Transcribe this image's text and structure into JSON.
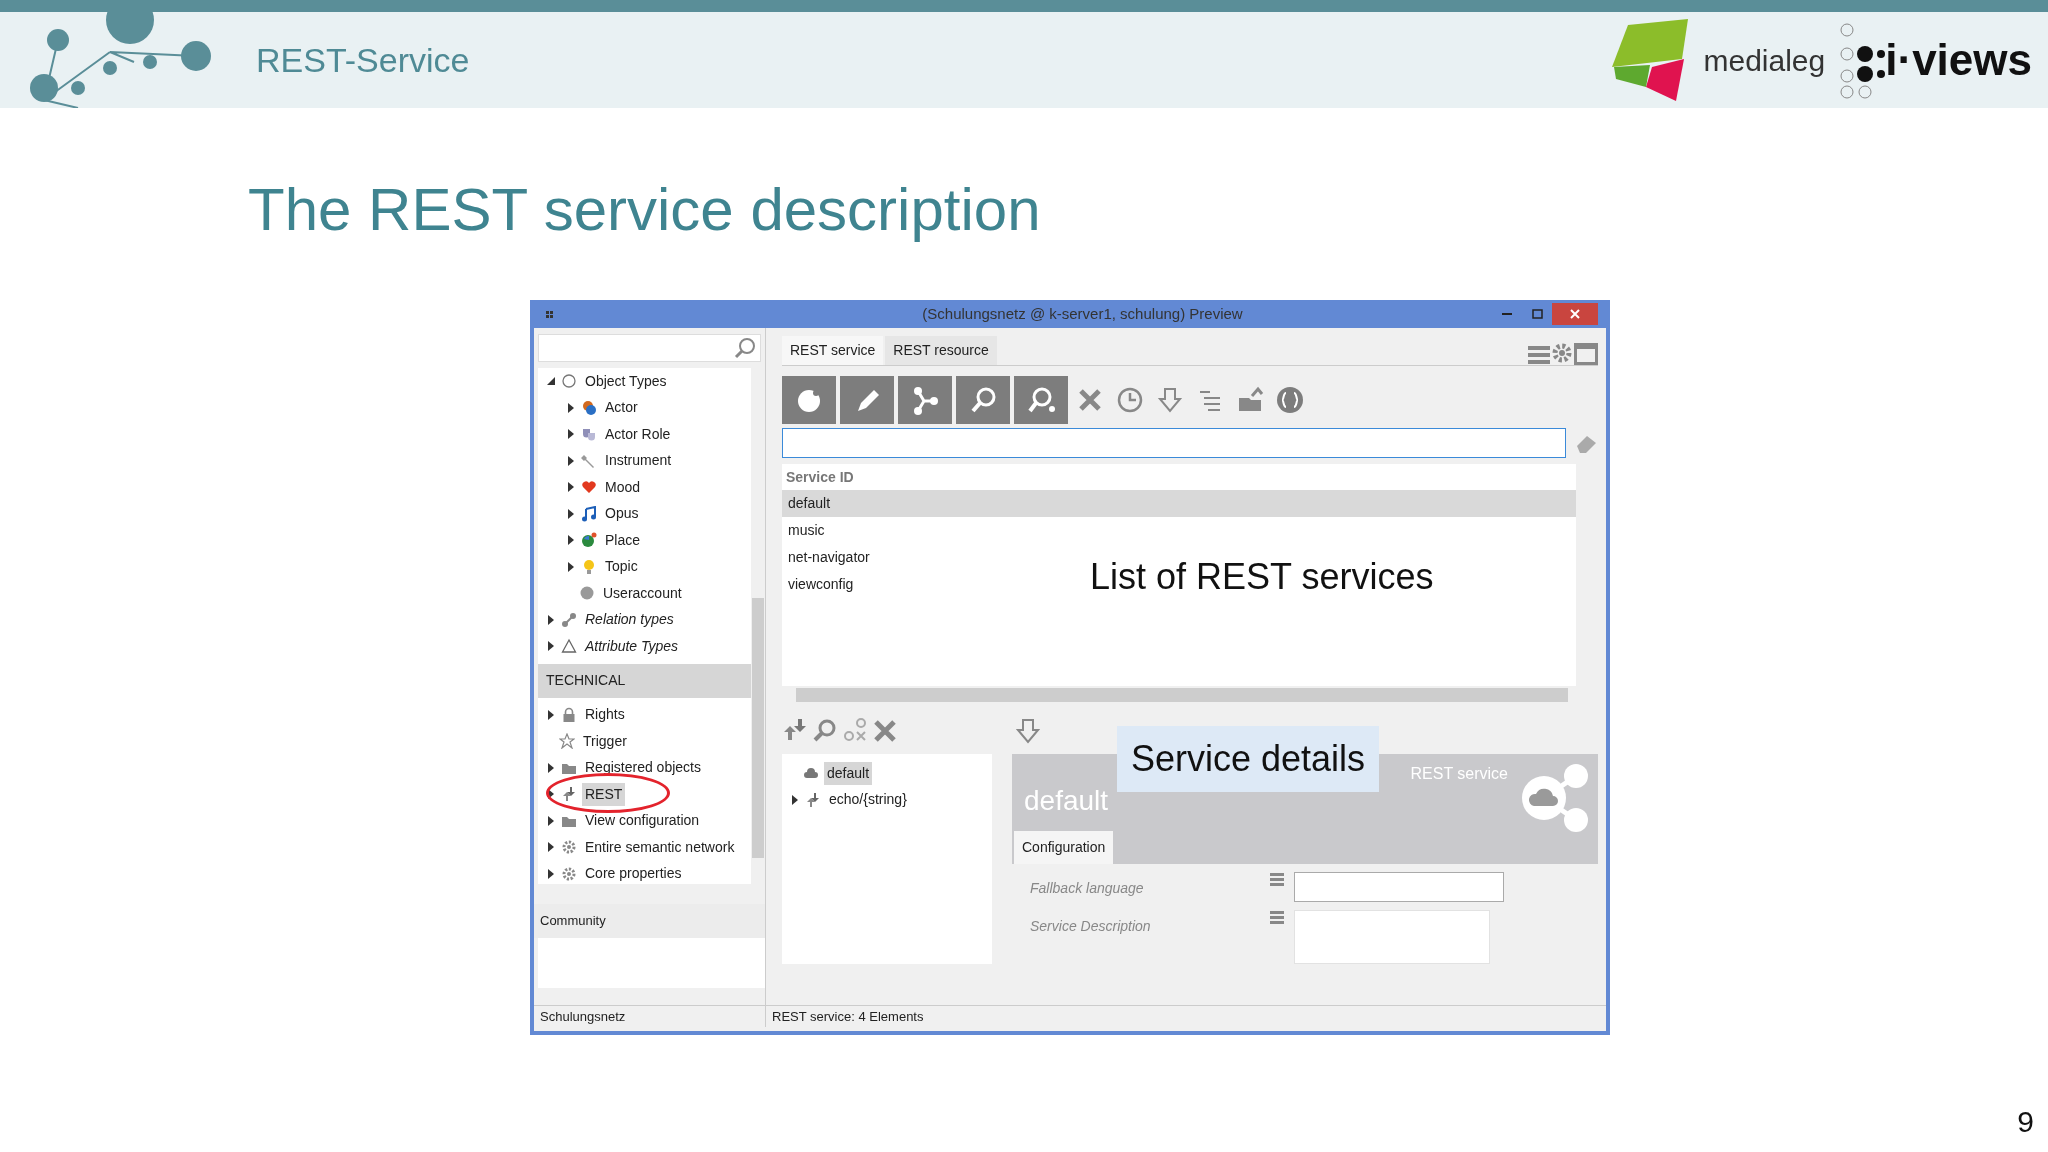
{
  "header": {
    "title": "REST-Service",
    "brand": "medialeg",
    "product": "i·views"
  },
  "slide_title": "The REST service description",
  "window": {
    "title": "(Schulungsnetz @ k-server1, schulung) Preview",
    "tree": [
      {
        "label": "Object Types",
        "kind": "ring",
        "italic": false,
        "expandable": true,
        "expanded": true,
        "selected": false,
        "children": [
          {
            "label": "Actor",
            "kind": "actor",
            "italic": false,
            "expandable": true,
            "selected": false
          },
          {
            "label": "Actor Role",
            "kind": "role",
            "italic": false,
            "expandable": true,
            "selected": false
          },
          {
            "label": "Instrument",
            "kind": "wrench",
            "italic": false,
            "expandable": true,
            "selected": false
          },
          {
            "label": "Mood",
            "kind": "heart",
            "italic": false,
            "expandable": true,
            "selected": false
          },
          {
            "label": "Opus",
            "kind": "note",
            "italic": false,
            "expandable": true,
            "selected": false
          },
          {
            "label": "Place",
            "kind": "globe",
            "italic": false,
            "expandable": true,
            "selected": false
          },
          {
            "label": "Topic",
            "kind": "bulb",
            "italic": false,
            "expandable": true,
            "selected": false
          },
          {
            "label": "Useraccount",
            "kind": "dot",
            "italic": false,
            "expandable": false,
            "selected": false
          }
        ]
      },
      {
        "label": "Relation types",
        "kind": "link",
        "italic": true,
        "expandable": true,
        "selected": false
      },
      {
        "label": "Attribute Types",
        "kind": "triangle",
        "italic": true,
        "expandable": true,
        "selected": false
      }
    ],
    "technical_heading": "TECHNICAL",
    "technical": [
      {
        "label": "Rights",
        "kind": "lock",
        "italic": false,
        "expandable": true,
        "selected": false
      },
      {
        "label": "Trigger",
        "kind": "star",
        "italic": false,
        "expandable": false,
        "selected": false
      },
      {
        "label": "Registered objects",
        "kind": "folder",
        "italic": false,
        "expandable": true,
        "selected": false
      },
      {
        "label": "REST",
        "kind": "rest",
        "italic": false,
        "expandable": true,
        "selected": true
      },
      {
        "label": "View configuration",
        "kind": "folder",
        "italic": false,
        "expandable": true,
        "selected": false
      },
      {
        "label": "Entire semantic network",
        "kind": "gear",
        "italic": false,
        "expandable": true,
        "selected": false
      },
      {
        "label": "Core properties",
        "kind": "gear",
        "italic": false,
        "expandable": true,
        "selected": false
      }
    ],
    "community_heading": "Community",
    "tabs": [
      {
        "label": "REST service",
        "selected": true
      },
      {
        "label": "REST resource",
        "selected": false
      }
    ],
    "columns": [
      "Service ID"
    ],
    "rows": [
      {
        "text": "default",
        "selected": true
      },
      {
        "text": "music",
        "selected": false
      },
      {
        "text": "net-navigator",
        "selected": false
      },
      {
        "text": "viewconfig",
        "selected": false
      }
    ],
    "resources": [
      {
        "label": "default",
        "kind": "cloud",
        "italic": false,
        "expandable": false,
        "selected": true
      },
      {
        "label": "echo/{string}",
        "kind": "rest",
        "italic": false,
        "expandable": true,
        "selected": false
      }
    ],
    "detail": {
      "type": "REST service",
      "title": "default",
      "tabs": [
        {
          "label": "Configuration",
          "selected": true
        }
      ],
      "fields": [
        {
          "label": "Fallback language",
          "kind": "line"
        },
        {
          "label": "Service Description",
          "kind": "area"
        }
      ]
    },
    "status_bar": [
      "Schulungsnetz",
      "REST service: 4 Elements"
    ]
  },
  "callouts": [
    "List of REST services",
    "Service details"
  ],
  "page_number": "9"
}
